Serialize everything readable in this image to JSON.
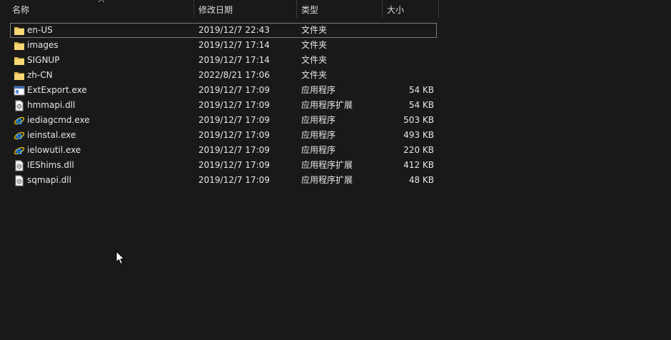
{
  "header": {
    "name": "名称",
    "date": "修改日期",
    "type": "类型",
    "size": "大小"
  },
  "files": [
    {
      "name": "en-US",
      "date": "2019/12/7 22:43",
      "type": "文件夹",
      "size": "",
      "icon": "folder-icon"
    },
    {
      "name": "images",
      "date": "2019/12/7 17:14",
      "type": "文件夹",
      "size": "",
      "icon": "folder-icon"
    },
    {
      "name": "SIGNUP",
      "date": "2019/12/7 17:14",
      "type": "文件夹",
      "size": "",
      "icon": "folder-icon"
    },
    {
      "name": "zh-CN",
      "date": "2022/8/21 17:06",
      "type": "文件夹",
      "size": "",
      "icon": "folder-icon"
    },
    {
      "name": "ExtExport.exe",
      "date": "2019/12/7 17:09",
      "type": "应用程序",
      "size": "54 KB",
      "icon": "application-icon"
    },
    {
      "name": "hmmapi.dll",
      "date": "2019/12/7 17:09",
      "type": "应用程序扩展",
      "size": "54 KB",
      "icon": "dll-file-icon"
    },
    {
      "name": "iediagcmd.exe",
      "date": "2019/12/7 17:09",
      "type": "应用程序",
      "size": "503 KB",
      "icon": "internet-explorer-icon"
    },
    {
      "name": "ieinstal.exe",
      "date": "2019/12/7 17:09",
      "type": "应用程序",
      "size": "493 KB",
      "icon": "internet-explorer-icon"
    },
    {
      "name": "ielowutil.exe",
      "date": "2019/12/7 17:09",
      "type": "应用程序",
      "size": "220 KB",
      "icon": "internet-explorer-icon"
    },
    {
      "name": "IEShims.dll",
      "date": "2019/12/7 17:09",
      "type": "应用程序扩展",
      "size": "412 KB",
      "icon": "dll-file-icon"
    },
    {
      "name": "sqmapi.dll",
      "date": "2019/12/7 17:09",
      "type": "应用程序扩展",
      "size": "48 KB",
      "icon": "dll-file-icon"
    }
  ],
  "colors": {
    "background": "#191919",
    "text": "#e6e6e6",
    "folder": "#f8d775",
    "ie_blue": "#1e88e5",
    "ie_ring": "#f9c40f"
  }
}
